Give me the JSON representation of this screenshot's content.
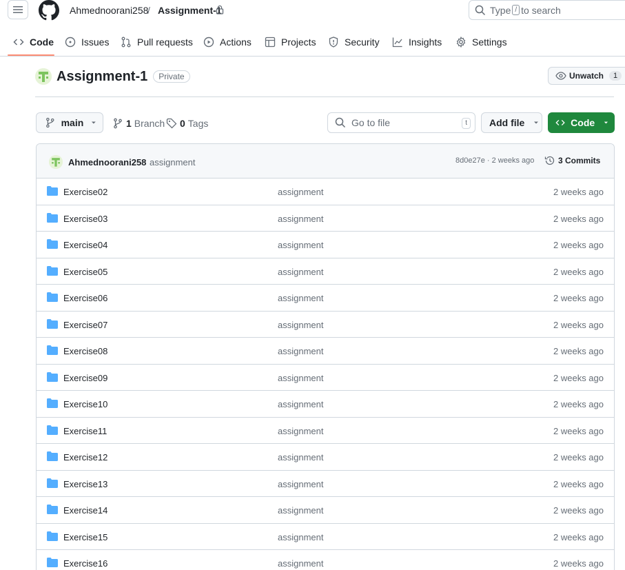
{
  "header": {
    "owner": "Ahmednoorani258",
    "separator": "/",
    "repo": "Assignment-1",
    "search_prefix": "Type",
    "search_key": "/",
    "search_suffix": "to search"
  },
  "tabs": [
    {
      "label": "Code",
      "icon": "code-icon"
    },
    {
      "label": "Issues",
      "icon": "issue-icon"
    },
    {
      "label": "Pull requests",
      "icon": "pull-request-icon"
    },
    {
      "label": "Actions",
      "icon": "play-icon"
    },
    {
      "label": "Projects",
      "icon": "table-icon"
    },
    {
      "label": "Security",
      "icon": "shield-icon"
    },
    {
      "label": "Insights",
      "icon": "graph-icon"
    },
    {
      "label": "Settings",
      "icon": "gear-icon"
    }
  ],
  "repo_header": {
    "title": "Assignment-1",
    "visibility": "Private",
    "unwatch_label": "Unwatch",
    "watch_count": "1"
  },
  "toolbar": {
    "branch": "main",
    "branch_count": "1",
    "branch_label": "Branch",
    "tag_count": "0",
    "tag_label": "Tags",
    "goto_placeholder": "Go to file",
    "goto_key": "t",
    "add_file": "Add file",
    "code": "Code"
  },
  "commit": {
    "author": "Ahmednoorani258",
    "message": "assignment",
    "sha_time": "8d0e27e · 2 weeks ago",
    "commits": "3 Commits"
  },
  "files": [
    {
      "name": "Exercise02",
      "message": "assignment",
      "time": "2 weeks ago"
    },
    {
      "name": "Exercise03",
      "message": "assignment",
      "time": "2 weeks ago"
    },
    {
      "name": "Exercise04",
      "message": "assignment",
      "time": "2 weeks ago"
    },
    {
      "name": "Exercise05",
      "message": "assignment",
      "time": "2 weeks ago"
    },
    {
      "name": "Exercise06",
      "message": "assignment",
      "time": "2 weeks ago"
    },
    {
      "name": "Exercise07",
      "message": "assignment",
      "time": "2 weeks ago"
    },
    {
      "name": "Exercise08",
      "message": "assignment",
      "time": "2 weeks ago"
    },
    {
      "name": "Exercise09",
      "message": "assignment",
      "time": "2 weeks ago"
    },
    {
      "name": "Exercise10",
      "message": "assignment",
      "time": "2 weeks ago"
    },
    {
      "name": "Exercise11",
      "message": "assignment",
      "time": "2 weeks ago"
    },
    {
      "name": "Exercise12",
      "message": "assignment",
      "time": "2 weeks ago"
    },
    {
      "name": "Exercise13",
      "message": "assignment",
      "time": "2 weeks ago"
    },
    {
      "name": "Exercise14",
      "message": "assignment",
      "time": "2 weeks ago"
    },
    {
      "name": "Exercise15",
      "message": "assignment",
      "time": "2 weeks ago"
    },
    {
      "name": "Exercise16",
      "message": "assignment",
      "time": "2 weeks ago"
    }
  ],
  "colors": {
    "accent": "#fd8c73",
    "primary_button": "#1f883d",
    "folder": "#54aeff",
    "muted_text": "#656d76",
    "border": "#d0d7de"
  }
}
